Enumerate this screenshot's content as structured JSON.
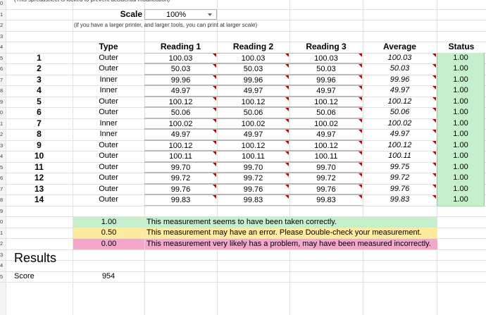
{
  "banner_text": "(This spreadsheet is locked to prevent accidental modification)",
  "row_labels": [
    "0",
    "1",
    "2",
    "3",
    "4",
    "5",
    "6",
    "7",
    "8",
    "9",
    "0",
    "1",
    "2",
    "3",
    "4",
    "5",
    "6",
    "7",
    "8",
    "9",
    "0",
    "1",
    "2",
    "3",
    "4",
    "5"
  ],
  "scale": {
    "label": "Scale",
    "value": "100%",
    "note": "(if you have a larger printer, and larger tools, you can print at larger scale)"
  },
  "table": {
    "headers": {
      "type": "Type",
      "reading1": "Reading 1",
      "reading2": "Reading 2",
      "reading3": "Reading 3",
      "average": "Average",
      "status": "Status"
    },
    "rows": [
      {
        "id": "1",
        "type": "Outer",
        "r1": "100.03",
        "r2": "100.03",
        "r3": "100.03",
        "avg": "100.03",
        "status": "1.00"
      },
      {
        "id": "2",
        "type": "Outer",
        "r1": "50.03",
        "r2": "50.03",
        "r3": "50.03",
        "avg": "50.03",
        "status": "1.00"
      },
      {
        "id": "3",
        "type": "Inner",
        "r1": "99.96",
        "r2": "99.96",
        "r3": "99.96",
        "avg": "99.96",
        "status": "1.00"
      },
      {
        "id": "4",
        "type": "Inner",
        "r1": "49.97",
        "r2": "49.97",
        "r3": "49.97",
        "avg": "49.97",
        "status": "1.00"
      },
      {
        "id": "5",
        "type": "Outer",
        "r1": "100.12",
        "r2": "100.12",
        "r3": "100.12",
        "avg": "100.12",
        "status": "1.00"
      },
      {
        "id": "6",
        "type": "Outer",
        "r1": "50.06",
        "r2": "50.06",
        "r3": "50.06",
        "avg": "50.06",
        "status": "1.00"
      },
      {
        "id": "7",
        "type": "Inner",
        "r1": "100.02",
        "r2": "100.02",
        "r3": "100.02",
        "avg": "100.02",
        "status": "1.00"
      },
      {
        "id": "8",
        "type": "Inner",
        "r1": "49.97",
        "r2": "49.97",
        "r3": "49.97",
        "avg": "49.97",
        "status": "1.00"
      },
      {
        "id": "9",
        "type": "Outer",
        "r1": "100.12",
        "r2": "100.12",
        "r3": "100.12",
        "avg": "100.12",
        "status": "1.00"
      },
      {
        "id": "10",
        "type": "Outer",
        "r1": "100.11",
        "r2": "100.11",
        "r3": "100.11",
        "avg": "100.11",
        "status": "1.00"
      },
      {
        "id": "11",
        "type": "Outer",
        "r1": "99.70",
        "r2": "99.70",
        "r3": "99.70",
        "avg": "99.75",
        "status": "1.00"
      },
      {
        "id": "12",
        "type": "Outer",
        "r1": "99.72",
        "r2": "99.72",
        "r3": "99.72",
        "avg": "99.72",
        "status": "1.00"
      },
      {
        "id": "13",
        "type": "Outer",
        "r1": "99.76",
        "r2": "99.76",
        "r3": "99.76",
        "avg": "99.76",
        "status": "1.00"
      },
      {
        "id": "14",
        "type": "Outer",
        "r1": "99.83",
        "r2": "99.83",
        "r3": "99.83",
        "avg": "99.83",
        "status": "1.00"
      }
    ]
  },
  "legend": [
    {
      "value": "1.00",
      "message": "This measurement seems to have been taken correctly.",
      "color": "#c6efce"
    },
    {
      "value": "0.50",
      "message": "This measurement may have an error. Please Double-check your measurement.",
      "color": "#ffeb9c"
    },
    {
      "value": "0.00",
      "message": "This measurement very likely has a problem, may have been measured incorrectly.",
      "color": "#f4a7c8"
    }
  ],
  "results": {
    "title": "Results",
    "score_label": "Score",
    "score_value": "954"
  },
  "colors": {
    "status_green": "#c6efce",
    "comment_marker": "#c00000",
    "gridline": "#e1e1e1"
  }
}
